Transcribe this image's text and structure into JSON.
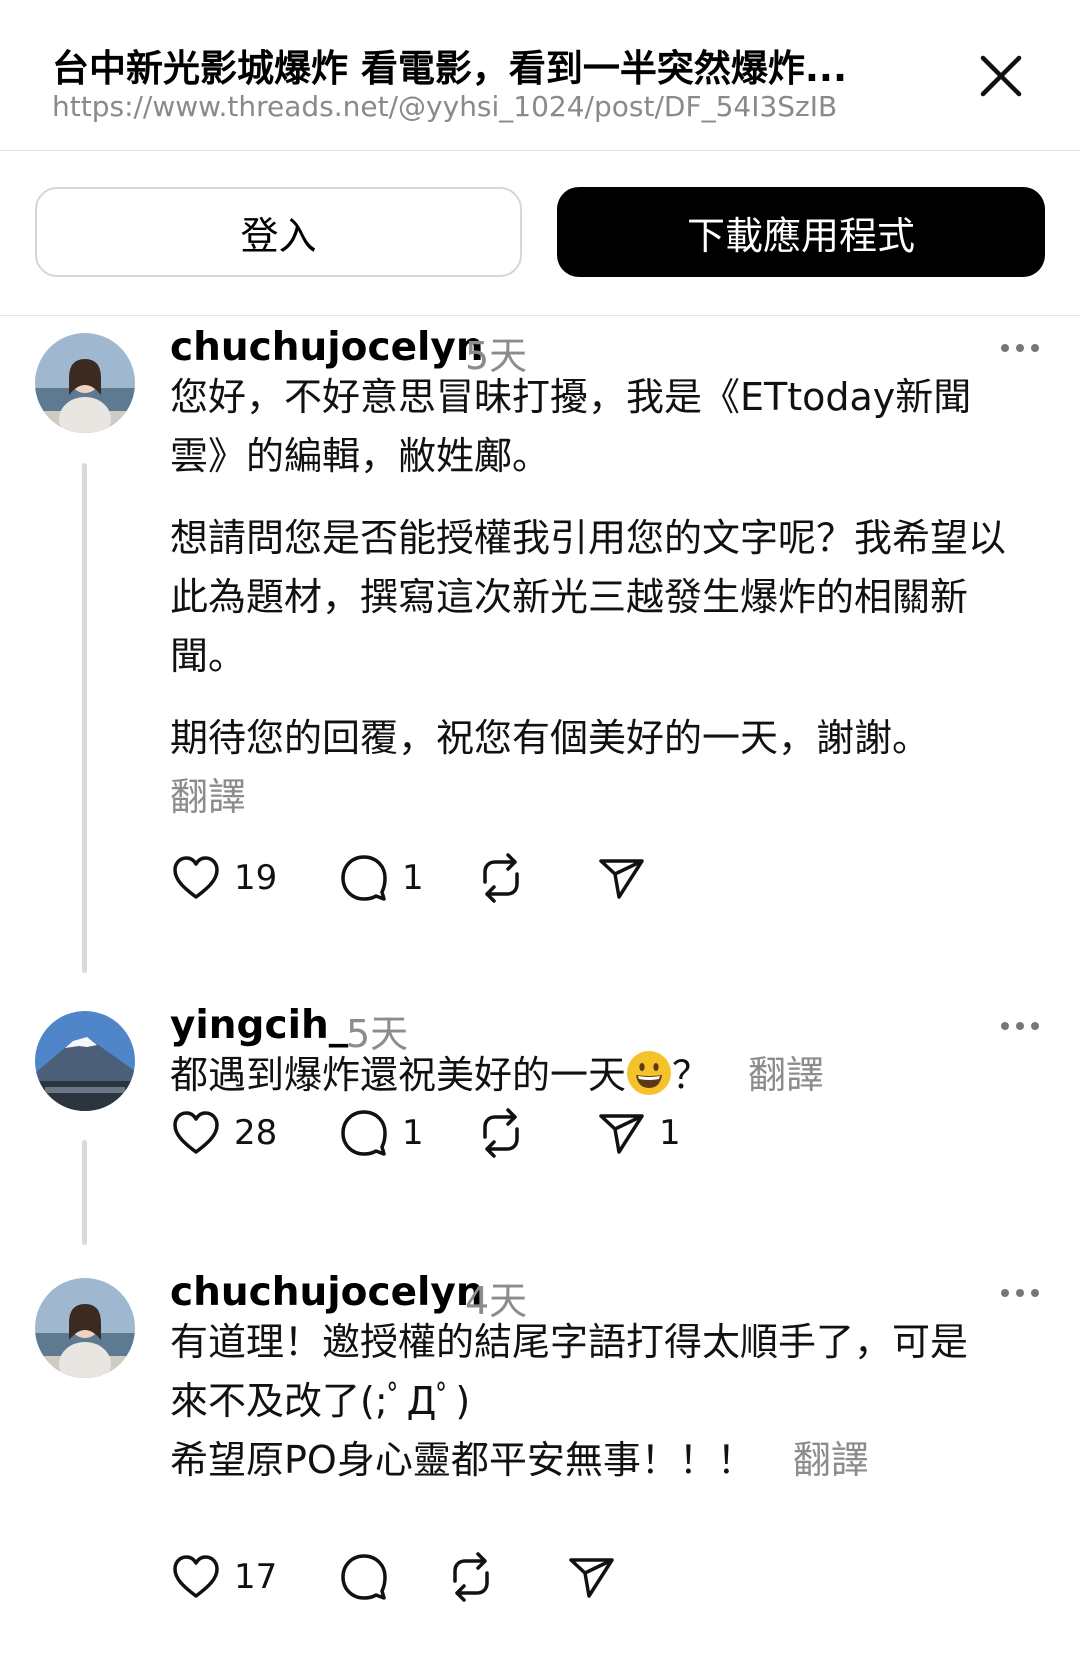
{
  "header": {
    "title": "台中新光影城爆炸 看電影，看到一半突然爆炸...",
    "url": "https://www.threads.net/@yyhsi_1024/post/DF_54I3SzIB"
  },
  "auth": {
    "login_label": "登入",
    "download_label": "下載應用程式"
  },
  "posts": [
    {
      "username": "chuchujocelyn",
      "time": "5天",
      "paragraphs": [
        "您好，不好意思冒昧打擾，我是《ETtoday新聞雲》的編輯，敝姓鄺。",
        "想請問您是否能授權我引用您的文字呢？我希望以此為題材，撰寫這次新光三越發生爆炸的相關新聞。",
        "期待您的回覆，祝您有個美好的一天，謝謝。"
      ],
      "translate": "翻譯",
      "likes": "19",
      "replies": "1"
    },
    {
      "username": "yingcih_",
      "time": "5天",
      "text_before": "都遇到爆炸還祝美好的一天",
      "text_after": "？",
      "emoji": "grinning-face",
      "translate": "翻譯",
      "likes": "28",
      "replies": "1",
      "shares": "1"
    },
    {
      "username": "chuchujocelyn",
      "time": "4天",
      "lines": [
        "有道理！邀授權的結尾字語打得太順手了，可是",
        "來不及改了(;ﾟДﾟ)",
        "希望原PO身心靈都平安無事！！！"
      ],
      "translate": "翻譯",
      "likes": "17"
    }
  ],
  "colors": {
    "muted": "#8c8c8c",
    "divider": "#e4e4e4",
    "button_dark": "#000000"
  }
}
